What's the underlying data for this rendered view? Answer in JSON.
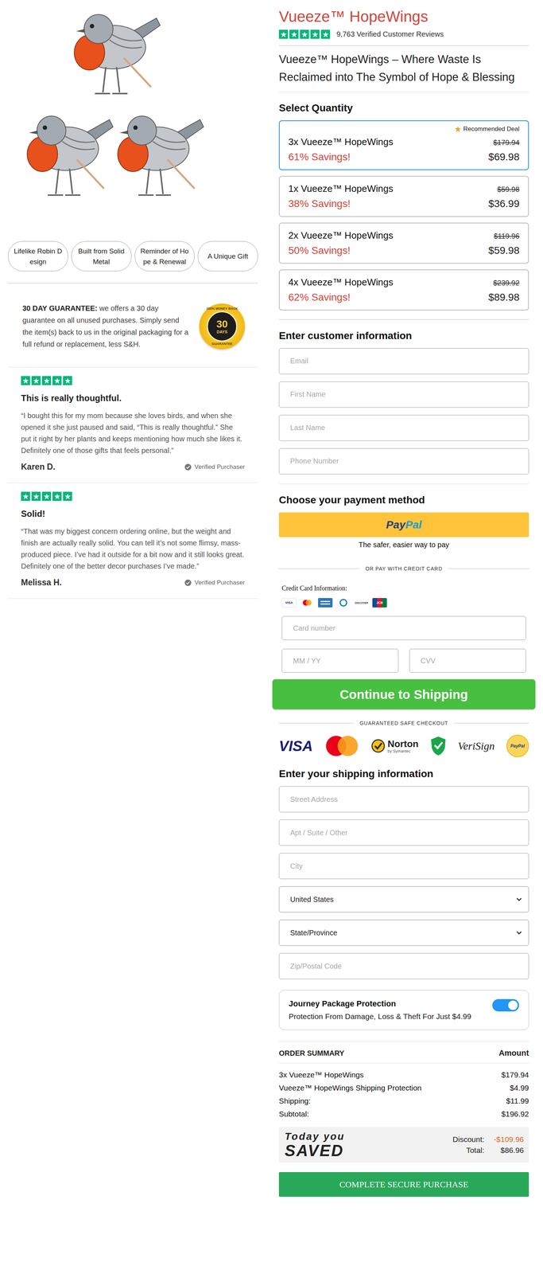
{
  "features": [
    "Lifelike Robin Design",
    "Built from Solid Metal",
    "Reminder of Hope & Renewal",
    "A Unique Gift"
  ],
  "guarantee": {
    "label": "30 DAY GUARANTEE:",
    "text": "we offers a 30 day guarantee on all unused purchases. Simply send the item(s) back to us in the original packaging for a full refund or replacement, less S&H.",
    "seal_top": "100% MONEY BACK",
    "seal_number": "30",
    "seal_unit": "DAYS",
    "seal_bottom": "GUARANTEE"
  },
  "reviews": [
    {
      "stars": 5,
      "title": "This is really thoughtful.",
      "body": "“I bought this for my mom because she loves birds, and when she opened it she just paused and said, “This is really thoughtful.” She put it right by her plants and keeps mentioning how much she likes it. Definitely one of those gifts that feels personal.”",
      "author": "Karen D.",
      "verified": "Verified Purchaser"
    },
    {
      "stars": 5,
      "title": "Solid!",
      "body": "“That was my biggest concern ordering online, but the weight and finish are actually really solid. You can tell it’s not some flimsy, mass-produced piece. I’ve had it outside for a bit now and it still looks great. Definitely one of the better decor purchases I’ve made.”",
      "author": "Melissa H.",
      "verified": "Verified Purchaser"
    }
  ],
  "header": {
    "title": "Vueeze™ HopeWings",
    "stars": 5,
    "reviews": "9,763 Verified Customer Reviews",
    "tagline": "Vueeze™ HopeWings – Where Waste Is Reclaimed into The Symbol of Hope & Blessing"
  },
  "quantity": {
    "heading": "Select Quantity",
    "options": [
      {
        "badge": "Recommended Deal",
        "name": "3x Vueeze™ HopeWings",
        "was": "$179.94",
        "savings": "61% Savings!",
        "price": "$69.98",
        "selected": true
      },
      {
        "name": "1x Vueeze™ HopeWings",
        "was": "$59.98",
        "savings": "38% Savings!",
        "price": "$36.99",
        "selected": false
      },
      {
        "name": "2x Vueeze™ HopeWings",
        "was": "$119.96",
        "savings": "50% Savings!",
        "price": "$59.98",
        "selected": false
      },
      {
        "name": "4x Vueeze™ HopeWings",
        "was": "$239.92",
        "savings": "62% Savings!",
        "price": "$89.98",
        "selected": false
      }
    ]
  },
  "customer": {
    "heading": "Enter customer information",
    "fields": [
      "Email",
      "First Name",
      "Last Name",
      "Phone Number"
    ]
  },
  "payment": {
    "heading": "Choose your payment method",
    "paypal": [
      "Pay",
      "Pal"
    ],
    "caption": "The safer, easier way to pay",
    "divider": "OR PAY WITH CREDIT CARD",
    "card_label": "Credit Card Information:",
    "card_icons": [
      {
        "kind": "visa",
        "text": "VISA"
      },
      {
        "kind": "mastercard"
      },
      {
        "kind": "amex"
      },
      {
        "kind": "diners"
      },
      {
        "kind": "discover",
        "text": "DISCOVER"
      },
      {
        "kind": "jcb",
        "text": "JCB"
      }
    ],
    "card_number": "Card number",
    "expiry": "MM / YY",
    "cvv": "CVV",
    "continue": "Continue to Shipping"
  },
  "trust": {
    "heading": "GUARANTEED SAFE CHECKOUT",
    "logos": [
      {
        "kind": "visa",
        "text": "VISA"
      },
      {
        "kind": "mastercard"
      },
      {
        "kind": "norton",
        "text": "Norton",
        "sub": "by Symantec"
      },
      {
        "kind": "shield"
      },
      {
        "kind": "verisign",
        "text": "VeriSign"
      },
      {
        "kind": "paypal",
        "text": "PayPal"
      }
    ]
  },
  "shipping": {
    "heading": "Enter your shipping information",
    "fields": [
      {
        "kind": "input",
        "text": "Street Address"
      },
      {
        "kind": "input",
        "text": "Apt / Suite / Other"
      },
      {
        "kind": "input",
        "text": "City"
      },
      {
        "kind": "select",
        "text": "United States"
      },
      {
        "kind": "select",
        "text": "State/Province"
      },
      {
        "kind": "input",
        "text": "Zip/Postal Code"
      }
    ]
  },
  "protection": {
    "title": "Journey Package Protection",
    "text": "Protection From Damage, Loss & Theft For Just $4.99",
    "on": true
  },
  "summary": {
    "heading": "ORDER SUMMARY",
    "amount_label": "Amount",
    "rows": [
      {
        "label": "3x Vueeze™ HopeWings",
        "amount": "$179.94"
      },
      {
        "label": "Vueeze™ HopeWings Shipping Protection",
        "amount": "$4.99"
      },
      {
        "label": "Shipping:",
        "amount": "$11.99"
      },
      {
        "label": "Subtotal:",
        "amount": "$196.92"
      }
    ],
    "saved": [
      "Today you",
      "SAVED"
    ],
    "discount": {
      "label": "Discount:",
      "value": "-$109.96"
    },
    "total": {
      "label": "Total:",
      "value": "$86.96"
    }
  },
  "buy": "COMPLETE SECURE PURCHASE"
}
